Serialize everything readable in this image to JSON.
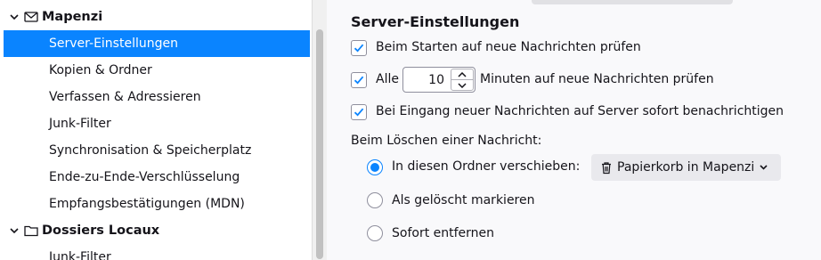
{
  "sidebar": {
    "account": {
      "name": "Mapenzi",
      "icon": "envelope-icon"
    },
    "items": [
      {
        "label": "Server-Einstellungen",
        "selected": true
      },
      {
        "label": "Kopien & Ordner"
      },
      {
        "label": "Verfassen & Adressieren"
      },
      {
        "label": "Junk-Filter"
      },
      {
        "label": "Synchronisation & Speicherplatz"
      },
      {
        "label": "Ende-zu-Ende-Verschlüsselung"
      },
      {
        "label": "Empfangsbestätigungen (MDN)"
      }
    ],
    "local": {
      "name": "Dossiers Locaux",
      "icon": "folder-icon"
    },
    "local_items": [
      {
        "label": "Junk-Filter"
      }
    ]
  },
  "main": {
    "title": "Server-Einstellungen",
    "check_startup": {
      "label": "Beim Starten auf neue Nachrichten prüfen",
      "checked": true
    },
    "check_interval": {
      "prefix": "Alle",
      "value": "10",
      "suffix": "Minuten auf neue Nachrichten prüfen",
      "checked": true
    },
    "check_notify": {
      "label": "Bei Eingang neuer Nachrichten auf Server sofort benachrichtigen",
      "checked": true
    },
    "delete_heading": "Beim Löschen einer Nachricht:",
    "delete_options": [
      {
        "label": "In diesen Ordner verschieben:",
        "selected": true
      },
      {
        "label": "Als gelöscht markieren",
        "selected": false
      },
      {
        "label": "Sofort entfernen",
        "selected": false
      }
    ],
    "trash_folder": {
      "label": "Papierkorb in Mapenzi",
      "icon": "trash-icon"
    }
  },
  "colors": {
    "accent": "#0a84ff",
    "selection_text": "#ffffff"
  }
}
